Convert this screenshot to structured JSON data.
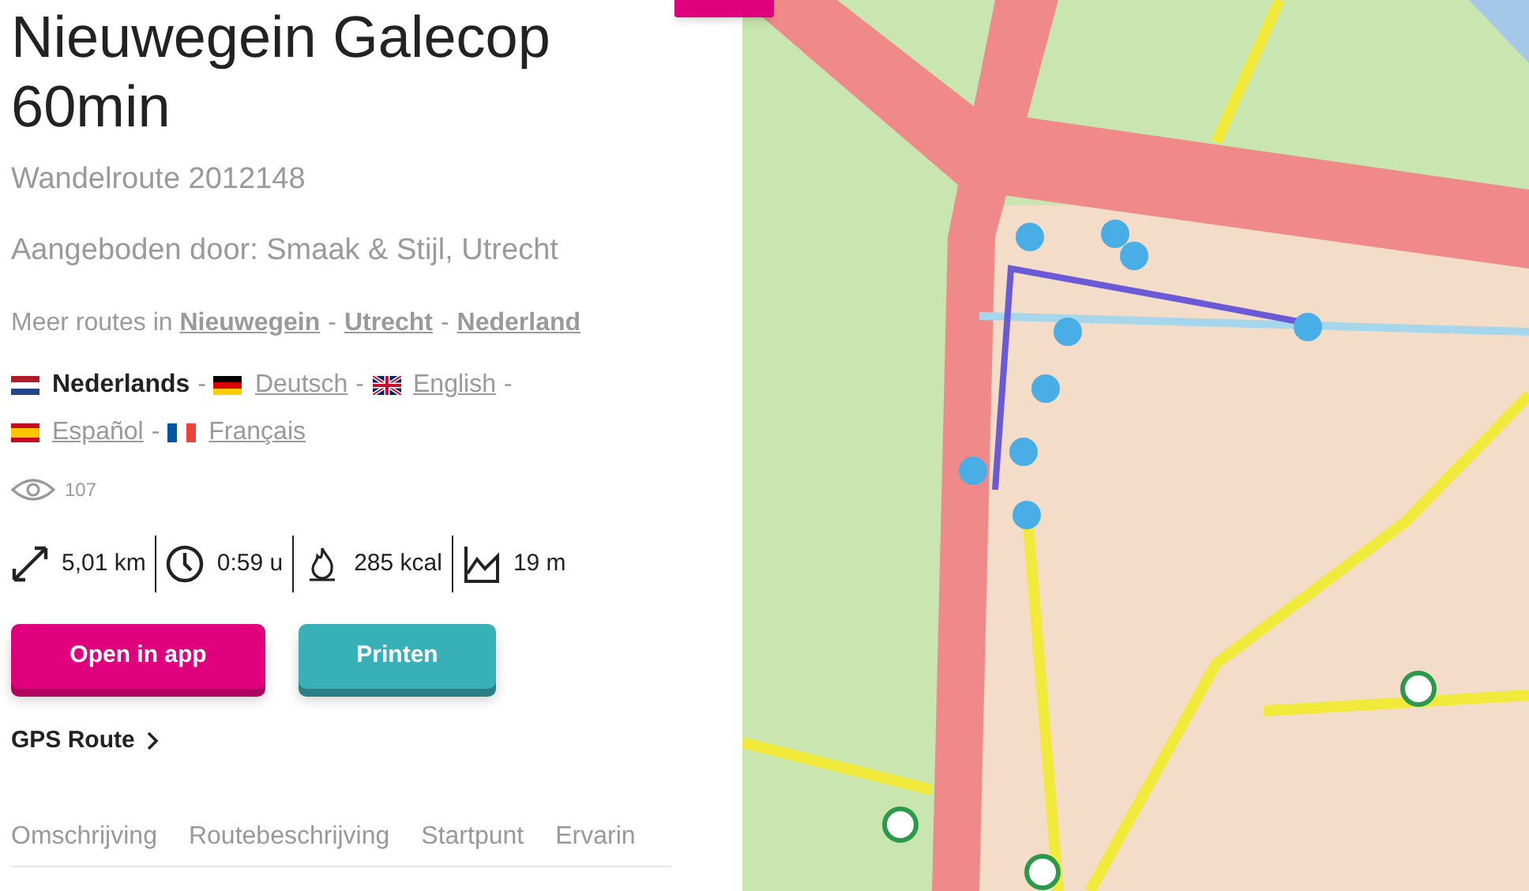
{
  "title_lines": [
    "Nieuwegein Galecop",
    "60min"
  ],
  "subtitle": "Wandelroute 2012148",
  "offered_by": "Aangeboden door: Smaak & Stijl, Utrecht",
  "more_routes": {
    "label": "Meer routes in",
    "links": [
      "Nieuwegein",
      "Utrecht",
      "Nederland"
    ],
    "separator": "-"
  },
  "language_separator": "-",
  "languages": [
    {
      "label": "Nederlands",
      "kind": "nl",
      "selected": true
    },
    {
      "label": "Deutsch",
      "kind": "de",
      "selected": false
    },
    {
      "label": "English",
      "kind": "gb",
      "selected": false
    },
    {
      "label": "Español",
      "kind": "es",
      "selected": false
    },
    {
      "label": "Français",
      "kind": "fr",
      "selected": false
    }
  ],
  "views": "107",
  "stats": [
    {
      "kind": "distance",
      "value": "5,01 km"
    },
    {
      "kind": "time",
      "value": "0:59 u"
    },
    {
      "kind": "calories",
      "value": "285 kcal"
    },
    {
      "kind": "elevation",
      "value": "19 m"
    }
  ],
  "buttons": [
    {
      "kind": "primary",
      "label": "Open in app"
    },
    {
      "kind": "secondary",
      "label": "Printen"
    }
  ],
  "gps_link": "GPS Route",
  "tabs": [
    "Omschrijving",
    "Routebeschrijving",
    "Startpunt",
    "Ervarin"
  ]
}
